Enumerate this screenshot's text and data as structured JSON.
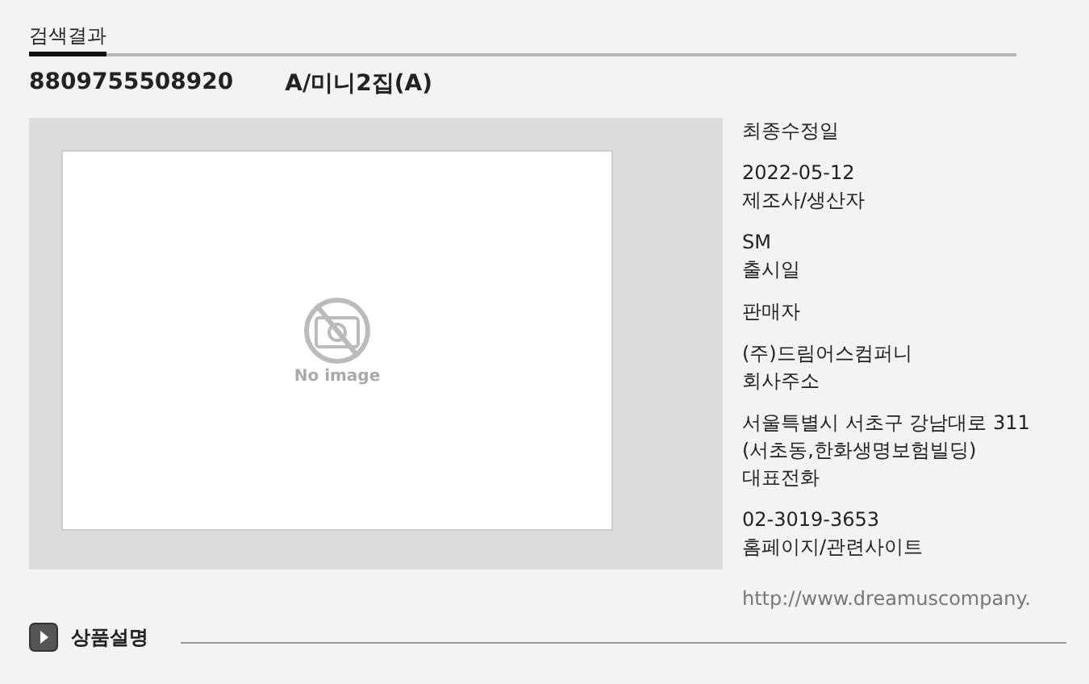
{
  "section_title": "검색결과",
  "product": {
    "barcode": "8809755508920",
    "name": "A/미니2집(A)"
  },
  "image": {
    "placeholder_text": "No image"
  },
  "details": [
    {
      "label": "최종수정일",
      "value": [
        "2022-05-12"
      ],
      "kind": "text"
    },
    {
      "label": "제조사/생산자",
      "value": [
        "SM"
      ],
      "kind": "text"
    },
    {
      "label": "출시일"
    },
    {
      "label": "판매자",
      "value": [
        "(주)드림어스컴퍼니"
      ],
      "kind": "text"
    },
    {
      "label": "회사주소",
      "value": [
        "서울특별시 서초구 강남대로 311",
        "(서초동,한화생명보험빌딩)"
      ],
      "kind": "text"
    },
    {
      "label": "대표전화",
      "value": [
        "02-3019-3653"
      ],
      "kind": "text"
    },
    {
      "label": "홈페이지/관련사이트",
      "value": [
        "http://www.dreamuscompany."
      ],
      "kind": "link"
    }
  ],
  "description_section": {
    "title": "상품설명"
  }
}
